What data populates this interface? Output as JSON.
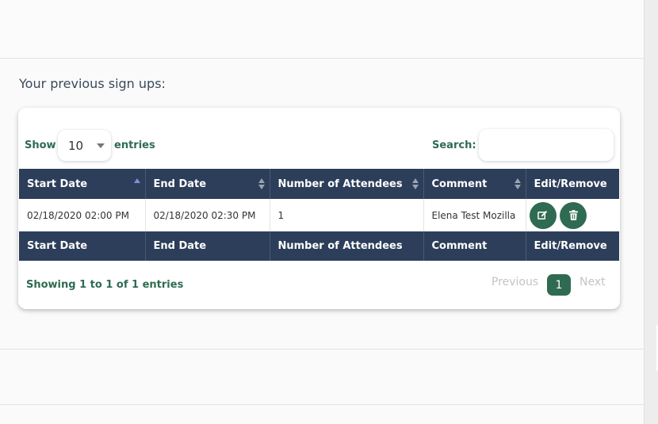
{
  "heading": "Your previous sign ups:",
  "length_menu": {
    "prefix": "Show",
    "value": "10",
    "suffix": "entries"
  },
  "search": {
    "label": "Search:",
    "value": "",
    "placeholder": ""
  },
  "columns": [
    "Start Date",
    "End Date",
    "Number of Attendees",
    "Comment",
    "Edit/Remove"
  ],
  "rows": [
    {
      "start": "02/18/2020 02:00 PM",
      "end": "02/18/2020 02:30 PM",
      "attendees": "1",
      "comment": "Elena Test Mozilla"
    }
  ],
  "info": "Showing 1 to 1 of 1 entries",
  "pagination": {
    "previous": "Previous",
    "current": "1",
    "next": "Next"
  },
  "colors": {
    "header": "#2c3e5a",
    "accent": "#2f6b52"
  },
  "icons": {
    "edit": "edit-icon",
    "delete": "trash-icon"
  }
}
